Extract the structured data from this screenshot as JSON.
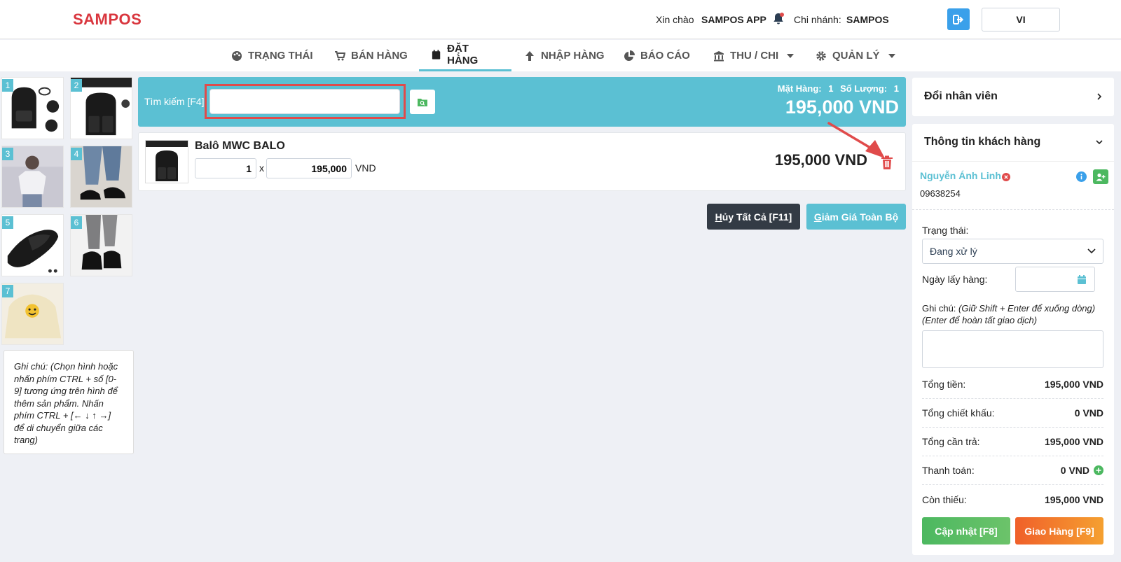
{
  "brand": {
    "logo": "SAMPOS"
  },
  "header": {
    "greeting_label": "Xin chào",
    "user": "SAMPOS APP",
    "branch_label": "Chi nhánh:",
    "branch": "SAMPOS",
    "lang": "VI"
  },
  "nav": {
    "items": [
      {
        "label": "TRẠNG THÁI",
        "icon": "palette-icon"
      },
      {
        "label": "BÁN HÀNG",
        "icon": "cart-icon"
      },
      {
        "label": "ĐẶT HÀNG",
        "icon": "calendar-icon",
        "active": true
      },
      {
        "label": "NHẬP HÀNG",
        "icon": "arrow-up-icon"
      },
      {
        "label": "BÁO CÁO",
        "icon": "pie-chart-icon"
      },
      {
        "label": "THU / CHI",
        "icon": "bank-icon",
        "dropdown": true
      },
      {
        "label": "QUẢN LÝ",
        "icon": "gear-icon",
        "dropdown": true
      }
    ]
  },
  "products": [
    {
      "num": "1"
    },
    {
      "num": "2"
    },
    {
      "num": "3"
    },
    {
      "num": "4"
    },
    {
      "num": "5"
    },
    {
      "num": "6"
    },
    {
      "num": "7"
    }
  ],
  "left_note": "Ghi chú: (Chọn hình hoặc nhấn phím CTRL + số [0-9] tương ứng trên hình để thêm sản phẩm. Nhấn phím CTRL + [← ↓ ↑ →] để di chuyển giữa các trang)",
  "search": {
    "label": "Tìm kiếm [F4]:",
    "value": "",
    "items_label": "Mặt Hàng:",
    "items_count": "1",
    "qty_label": "Số Lượng:",
    "qty_count": "1",
    "total": "195,000 VND"
  },
  "order_item": {
    "name": "Balô MWC BALO",
    "qty": "1",
    "times": "x",
    "price": "195,000",
    "currency": "VND",
    "line_total": "195,000 VND"
  },
  "actions": {
    "cancel_all_u": "H",
    "cancel_all": "ủy Tất Cả [F11]",
    "discount_all_u": "G",
    "discount_all": "iảm Giá Toàn Bộ"
  },
  "right": {
    "change_staff": "Đổi nhân viên",
    "customer_info": "Thông tin khách hàng",
    "customer_name": "Nguyễn Ánh Linh",
    "customer_phone": "09638254",
    "status_label": "Trạng thái:",
    "status_value": "Đang xử lý",
    "pickup_label": "Ngày lấy hàng:",
    "note_label": "Ghi chú:",
    "note_hint1": "(Giữ Shift + Enter để xuống dòng)",
    "note_hint2": "(Enter để hoàn tất giao dịch)",
    "note_value": "",
    "summary": [
      {
        "label": "Tổng tiền:",
        "value": "195,000 VND"
      },
      {
        "label": "Tổng chiết khấu:",
        "value": "0 VND"
      },
      {
        "label": "Tổng cần trả:",
        "value": "195,000 VND"
      },
      {
        "label": "Thanh toán:",
        "value": "0 VND"
      },
      {
        "label": "Còn thiếu:",
        "value": "195,000 VND"
      }
    ],
    "update_btn": "Cập nhật [F8]",
    "deliver_btn": "Giao Hàng [F9]"
  },
  "colors": {
    "brand": "#d9363e",
    "accent": "#5bc0d3",
    "green": "#4cb860",
    "orange": "#f0702a",
    "danger": "#e04b4b"
  }
}
